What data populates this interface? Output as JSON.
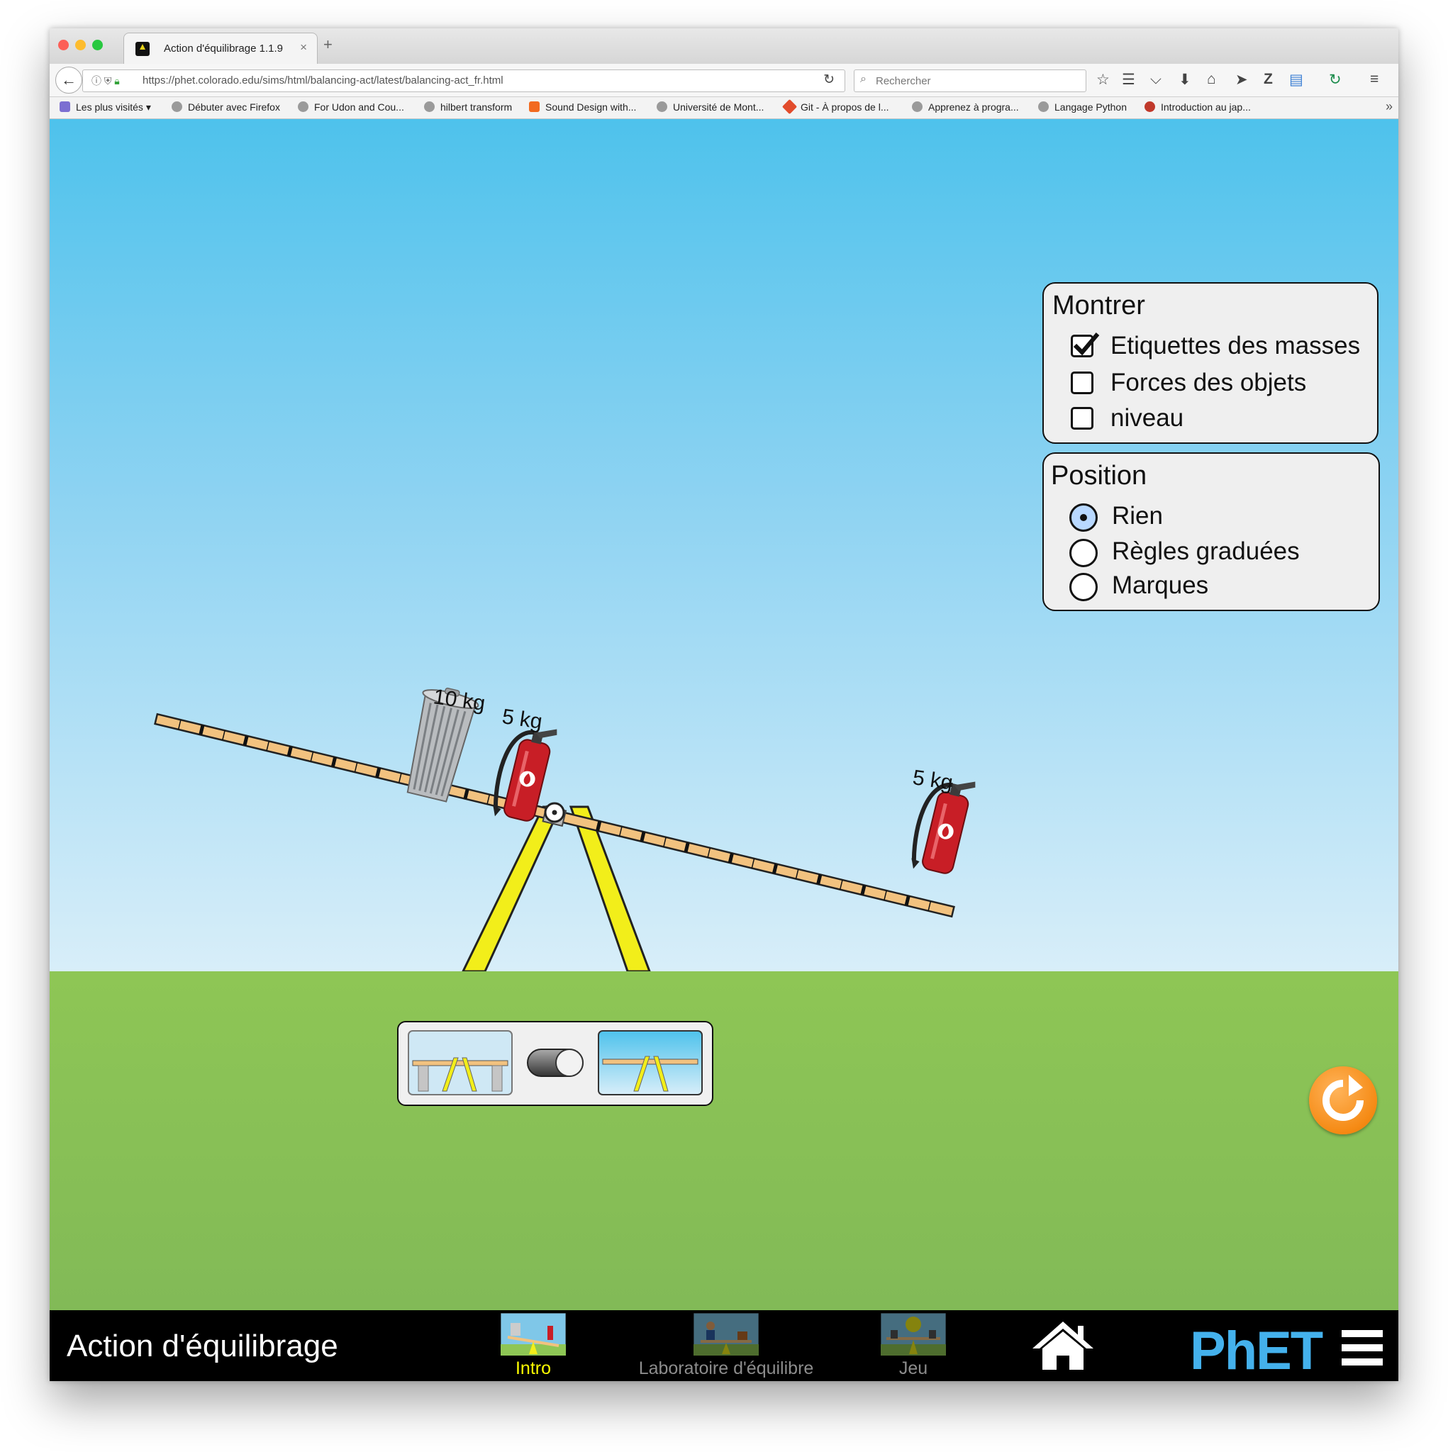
{
  "browser": {
    "tab_title": "Action d'équilibrage 1.1.9",
    "tab_close": "×",
    "new_tab": "+",
    "url": "https://phet.colorado.edu/sims/html/balancing-act/latest/balancing-act_fr.html",
    "search_placeholder": "Rechercher",
    "bookmarks": [
      "Les plus visités",
      "Débuter avec Firefox",
      "For Udon and Cou...",
      "hilbert transform",
      "Sound Design with...",
      "Université de Mont...",
      "Git - À propos de l...",
      "Apprenez à progra...",
      "Langage Python",
      "Introduction au jap..."
    ]
  },
  "sim": {
    "masses": [
      {
        "label": "10 kg",
        "kind": "trash-can"
      },
      {
        "label": "5 kg",
        "kind": "fire-extinguisher"
      },
      {
        "label": "5 kg",
        "kind": "fire-extinguisher"
      }
    ],
    "show_panel": {
      "title": "Montrer",
      "options": [
        {
          "label": "Etiquettes des masses",
          "checked": true
        },
        {
          "label": "Forces des objets",
          "checked": false
        },
        {
          "label": "niveau",
          "checked": false
        }
      ]
    },
    "position_panel": {
      "title": "Position",
      "options": [
        {
          "label": "Rien",
          "selected": true
        },
        {
          "label": "Règles graduées",
          "selected": false
        },
        {
          "label": "Marques",
          "selected": false
        }
      ]
    },
    "support_toggle": {
      "state": "right"
    }
  },
  "footer": {
    "title": "Action d'équilibrage",
    "screens": [
      {
        "label": "Intro",
        "active": true
      },
      {
        "label": "Laboratoire d'équilibre",
        "active": false
      },
      {
        "label": "Jeu",
        "active": false
      }
    ],
    "logo": "PhET",
    "colors": {
      "active": "#ffff00",
      "inactive": "#8c8c8c",
      "brand": "#44b1ec"
    }
  }
}
